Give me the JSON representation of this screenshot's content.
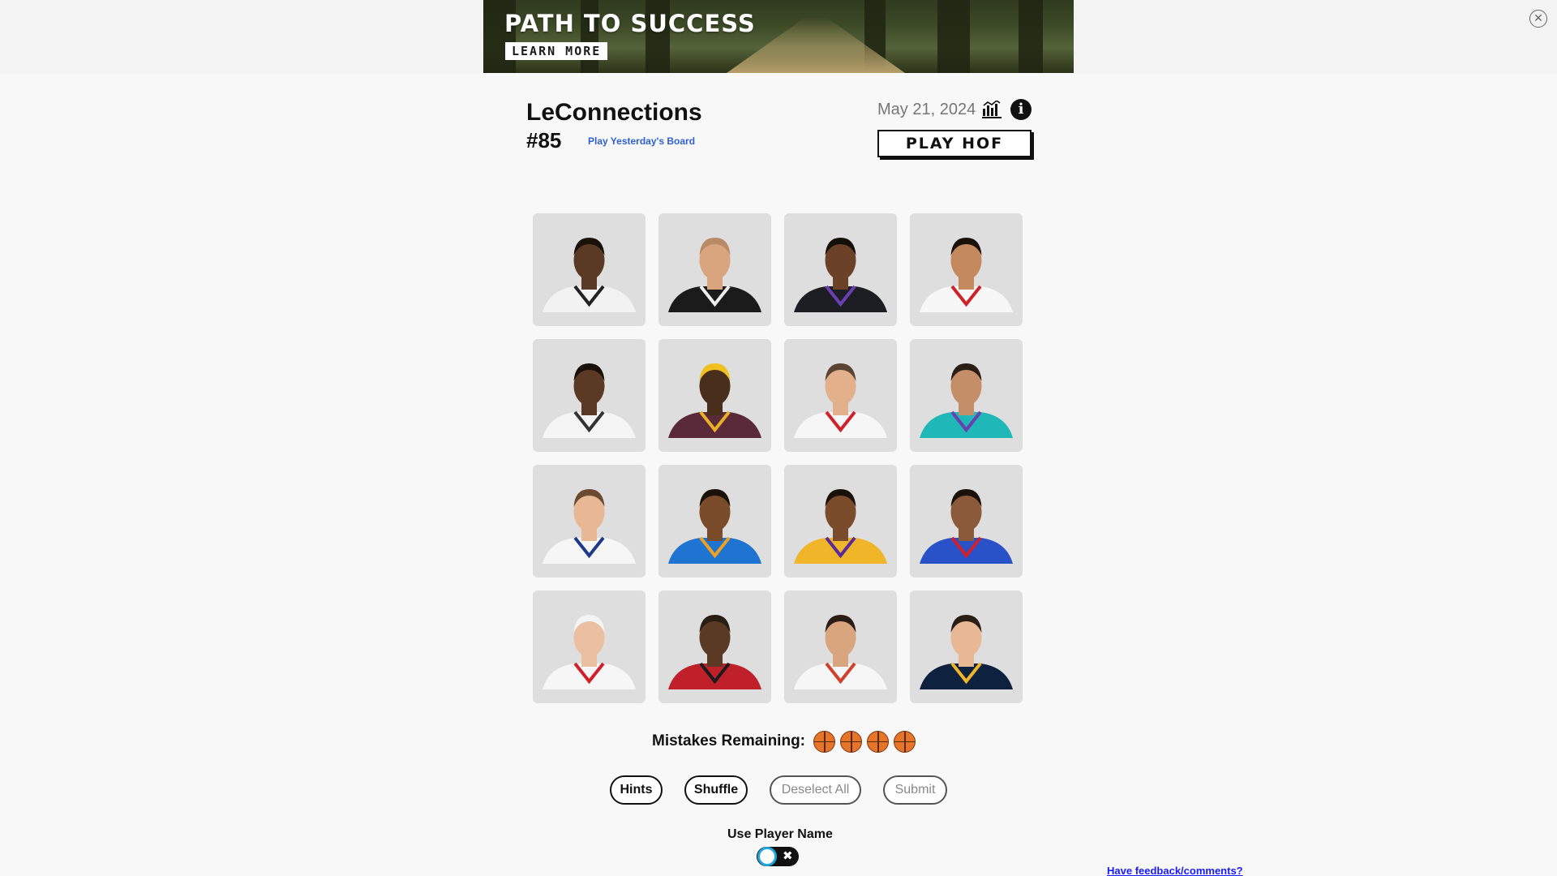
{
  "ad": {
    "headline": "PATH TO SUCCESS",
    "cta": "LEARN MORE",
    "close_glyph": "✕"
  },
  "header": {
    "title": "LeConnections",
    "puzzle_number": "#85",
    "yesterday_link": "Play Yesterday's Board",
    "date": "May 21, 2024",
    "stats_icon": "bar-chart-icon",
    "info_icon": "info-icon",
    "info_glyph": "i",
    "play_hof_label": "PLAY HOF"
  },
  "tiles": [
    {
      "skin": "#5a3a24",
      "hair": "#1a1208",
      "jersey": "#f2f2f2",
      "trim": "#222222"
    },
    {
      "skin": "#d8a57e",
      "hair": "#b88a66",
      "jersey": "#1b1b1b",
      "trim": "#eeeeee"
    },
    {
      "skin": "#6b4128",
      "hair": "#141008",
      "jersey": "#1d1d24",
      "trim": "#6a3fb0"
    },
    {
      "skin": "#c48a5e",
      "hair": "#1a1208",
      "jersey": "#f7f7f7",
      "trim": "#d0202a"
    },
    {
      "skin": "#5a3a24",
      "hair": "#1a1208",
      "jersey": "#f5f5f5",
      "trim": "#333333"
    },
    {
      "skin": "#4a2e1c",
      "hair": "#f0c020",
      "jersey": "#5a2a3a",
      "trim": "#e8b028"
    },
    {
      "skin": "#e2b08a",
      "hair": "#5a4434",
      "jersey": "#f6f6f6",
      "trim": "#d0202a"
    },
    {
      "skin": "#c48e68",
      "hair": "#2a1d14",
      "jersey": "#1fb7b8",
      "trim": "#6a3fb0"
    },
    {
      "skin": "#e8b894",
      "hair": "#6a4a30",
      "jersey": "#f6f6f6",
      "trim": "#1e3a8a"
    },
    {
      "skin": "#7a4c2c",
      "hair": "#1a1208",
      "jersey": "#1e74d0",
      "trim": "#f0a020"
    },
    {
      "skin": "#7a4c2c",
      "hair": "#1a1208",
      "jersey": "#f0b528",
      "trim": "#5a2a9a"
    },
    {
      "skin": "#8a5a3a",
      "hair": "#1a1208",
      "jersey": "#2a52c8",
      "trim": "#d0202a"
    },
    {
      "skin": "#ebc0a0",
      "hair": "#f4f4f4",
      "jersey": "#f6f6f6",
      "trim": "#d0202a"
    },
    {
      "skin": "#5a3a24",
      "hair": "#2a1d14",
      "jersey": "#c0202a",
      "trim": "#1b1b1b"
    },
    {
      "skin": "#d8a57e",
      "hair": "#2a1d14",
      "jersey": "#f6f6f6",
      "trim": "#d0402a"
    },
    {
      "skin": "#e8b894",
      "hair": "#2a1d14",
      "jersey": "#0e2240",
      "trim": "#f0b528"
    }
  ],
  "mistakes": {
    "label": "Mistakes Remaining:",
    "remaining": 4
  },
  "actions": {
    "hints": "Hints",
    "shuffle": "Shuffle",
    "deselect_all": "Deselect All",
    "submit": "Submit"
  },
  "toggle": {
    "label": "Use Player Name",
    "off_glyph": "✖"
  },
  "footer": {
    "feedback_link": "Have feedback/comments?"
  },
  "colors": {
    "accent_link": "#2f5fd0",
    "toggle_ring": "#1da6e0",
    "basketball": "#e6752a"
  }
}
